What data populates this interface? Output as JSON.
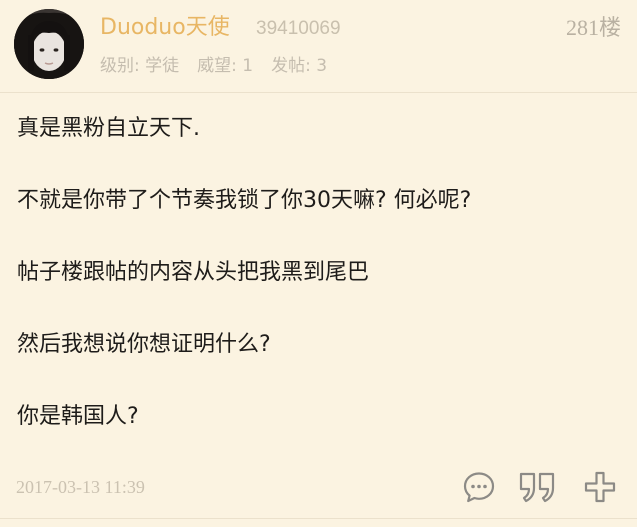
{
  "post": {
    "username": "Duoduo天使",
    "user_id": "39410069",
    "floor": "281楼",
    "stats": {
      "level": "级别: 学徒",
      "prestige": "威望: 1",
      "posts": "发帖: 3"
    },
    "content": [
      "真是黑粉自立天下.",
      "不就是你带了个节奏我锁了你30天嘛? 何必呢?",
      "帖子楼跟帖的内容从头把我黑到尾巴",
      "然后我想说你想证明什么?",
      "你是韩国人?"
    ],
    "timestamp": "2017-03-13 11:39"
  },
  "icons": {
    "comment": "comment-bubble-icon",
    "quote": "quote-icon",
    "add": "plus-icon"
  },
  "colors": {
    "background": "#fbf3e1",
    "username": "#e8b664",
    "muted": "#c5bdaf",
    "text": "#1e1c1a",
    "icon": "#8c8a86"
  }
}
